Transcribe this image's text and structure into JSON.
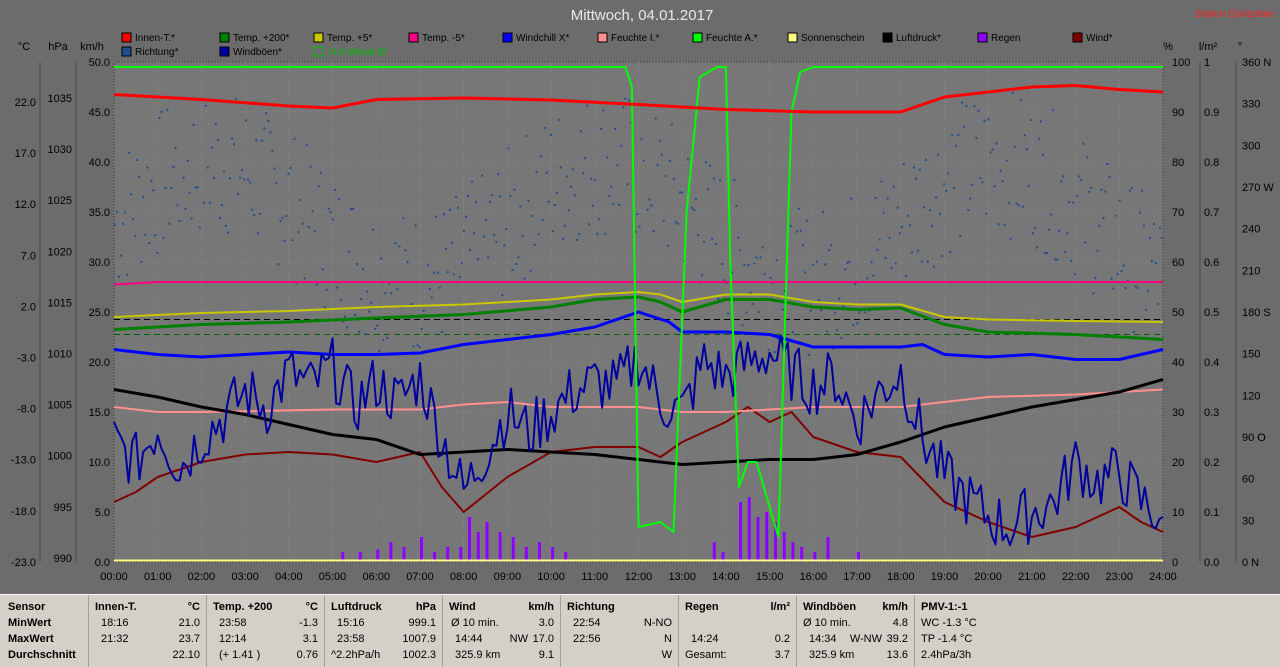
{
  "title": "Mittwoch, 04.01.2017",
  "station": "Station Göritzhain",
  "colors": {
    "background": "#6c6c6c",
    "plot_bg": "#757575",
    "innen": "#ff0000",
    "temp200": "#008000",
    "temp5": "#c8c800",
    "temp_5": "#ff0080",
    "windchill": "#0000ff",
    "feuchte_i": "#ff9090",
    "feuchte_a": "#00ff00",
    "sonnenschein": "#ffff80",
    "luftdruck": "#000000",
    "regen": "#9000ff",
    "wind": "#800000",
    "richtung": "#1f4f8f",
    "windboeen": "#0000a0",
    "monat": "#00c000",
    "station_text": "#ff0000"
  },
  "legend": [
    {
      "label": "Innen-T.*",
      "color": "#ff0000"
    },
    {
      "label": "Temp. +200*",
      "color": "#008000"
    },
    {
      "label": "Temp. +5*",
      "color": "#c8c800"
    },
    {
      "label": "Temp. -5*",
      "color": "#ff0080"
    },
    {
      "label": "Windchill X*",
      "color": "#0000ff"
    },
    {
      "label": "Feuchte I.*",
      "color": "#ff9090"
    },
    {
      "label": "Feuchte A.*",
      "color": "#00ff00"
    },
    {
      "label": "Sonnenschein",
      "color": "#ffff80"
    },
    {
      "label": "Luftdruck*",
      "color": "#000000"
    },
    {
      "label": "Regen",
      "color": "#9000ff"
    },
    {
      "label": "Wind*",
      "color": "#800000"
    },
    {
      "label": "Richtung*",
      "color": "#1f4f8f"
    },
    {
      "label": "Windböen*",
      "color": "#0000a0"
    },
    {
      "label": "-0.6 Monat-Ø",
      "color": "#00c000",
      "outline": true
    }
  ],
  "axis_headers": {
    "c": "°C",
    "hpa": "hPa",
    "kmh": "km/h",
    "pct": "%",
    "lm2": "l/m²",
    "deg": "°"
  },
  "axes": {
    "temp": [
      "22.0",
      "17.0",
      "12.0",
      "7.0",
      "2.0",
      "-3.0",
      "-8.0",
      "-13.0",
      "-18.0",
      "-23.0"
    ],
    "hpa": [
      "1035",
      "1030",
      "1025",
      "1020",
      "1015",
      "1010",
      "1005",
      "1000",
      "995",
      "990"
    ],
    "kmh": [
      "50.0",
      "45.0",
      "40.0",
      "35.0",
      "30.0",
      "25.0",
      "20.0",
      "15.0",
      "10.0",
      "5.0",
      "0.0"
    ],
    "pct": [
      "100",
      "90",
      "80",
      "70",
      "60",
      "50",
      "40",
      "30",
      "20",
      "10",
      "0"
    ],
    "lm2": [
      "1",
      "0.9",
      "0.8",
      "0.7",
      "0.6",
      "0.5",
      "0.4",
      "0.3",
      "0.2",
      "0.1",
      "0.0"
    ],
    "deg": [
      "360 N",
      "330",
      "300",
      "270 W",
      "240",
      "210",
      "180 S",
      "150",
      "120",
      "90 O",
      "60",
      "30",
      "0 N"
    ],
    "x": [
      "00:00",
      "01:00",
      "02:00",
      "03:00",
      "04:00",
      "05:00",
      "06:00",
      "07:00",
      "08:00",
      "09:00",
      "10:00",
      "11:00",
      "12:00",
      "13:00",
      "14:00",
      "15:00",
      "16:00",
      "17:00",
      "18:00",
      "19:00",
      "20:00",
      "21:00",
      "22:00",
      "23:00",
      "24:00"
    ]
  },
  "chart_data": {
    "type": "line",
    "title": "Mittwoch, 04.01.2017",
    "x_unit": "hour",
    "xlim": [
      0,
      24
    ],
    "ylim_kmh": [
      0,
      50
    ],
    "ylim_pct": [
      0,
      100
    ],
    "grid": true,
    "series": [
      {
        "name": "Innen-T.*",
        "axis": "pct",
        "x": [
          0,
          2,
          4,
          5,
          6,
          8,
          10,
          12,
          14,
          16,
          18,
          19,
          21,
          22,
          23,
          24
        ],
        "y": [
          93.5,
          92.5,
          91.2,
          90.8,
          92.5,
          92.8,
          92.4,
          91.5,
          90.5,
          90,
          90,
          93,
          95,
          95.3,
          94.5,
          94
        ]
      },
      {
        "name": "Temp. +200*",
        "axis": "pct",
        "x": [
          0,
          2,
          4,
          6,
          8,
          10,
          11,
          12,
          12.5,
          13,
          14,
          15,
          16,
          17,
          18,
          19,
          20,
          22,
          24
        ],
        "y": [
          46.5,
          47.5,
          48,
          48.8,
          49.5,
          51,
          52.5,
          53,
          52,
          50,
          52.5,
          52.5,
          51,
          50.5,
          50.8,
          47.5,
          46,
          45.5,
          44.5
        ]
      },
      {
        "name": "Temp. +5*",
        "axis": "pct",
        "x": [
          0,
          2,
          4,
          6,
          8,
          10,
          11,
          12,
          12.5,
          13,
          14,
          15,
          16,
          17,
          18,
          19,
          20,
          22,
          24
        ],
        "y": [
          49,
          49.8,
          50.2,
          51,
          51.5,
          52.5,
          53.5,
          54,
          53.5,
          52,
          53.5,
          53.5,
          52,
          51.5,
          51.5,
          49,
          48.5,
          48.2,
          48
        ]
      },
      {
        "name": "Temp. -5*",
        "axis": "pct",
        "x": [
          0,
          1,
          24
        ],
        "y": [
          55.5,
          56,
          56
        ]
      },
      {
        "name": "Windchill X*",
        "axis": "pct",
        "x": [
          0,
          1,
          2,
          3,
          4,
          5,
          6,
          7,
          8,
          9,
          10,
          11,
          12,
          12.7,
          13,
          14,
          15,
          16,
          17,
          18,
          18.5,
          19,
          20,
          21,
          22,
          23,
          24
        ],
        "y": [
          42.5,
          41.5,
          41,
          41.5,
          42,
          41.5,
          41.5,
          41.8,
          43.5,
          44.5,
          45.5,
          47,
          50,
          48,
          46,
          46,
          45.5,
          43,
          43,
          43,
          43.5,
          41.5,
          41,
          41.5,
          40.5,
          40.5,
          42.5
        ]
      },
      {
        "name": "Feuchte I.*",
        "axis": "pct",
        "x": [
          0,
          1,
          2,
          5,
          7,
          8,
          9,
          10,
          11,
          12,
          13,
          14,
          15,
          16,
          17,
          18,
          19,
          20,
          22,
          23,
          24
        ],
        "y": [
          31,
          30,
          30,
          30.5,
          30.5,
          31.5,
          32,
          31,
          31,
          31,
          30,
          30,
          30.5,
          31,
          31,
          31,
          32,
          33,
          33.5,
          34,
          34.5
        ]
      },
      {
        "name": "Feuchte A.*",
        "axis": "pct",
        "x": [
          0,
          11.7,
          11.85,
          12,
          12.5,
          12.8,
          13.1,
          13.4,
          13.8,
          14,
          14.1,
          14.3,
          14.5,
          14.7,
          15.2,
          15.5,
          15.7,
          16,
          24
        ],
        "y": [
          99,
          99,
          95,
          7,
          8,
          6,
          70,
          97,
          99,
          99,
          60,
          15,
          20,
          20,
          5,
          90,
          98,
          99,
          99
        ]
      },
      {
        "name": "Sonnenschein",
        "axis": "pct",
        "x": [
          0,
          24
        ],
        "y": [
          0.3,
          0.3
        ]
      },
      {
        "name": "Luftdruck*",
        "axis": "pct",
        "x": [
          0,
          1,
          2,
          3,
          4,
          5,
          6,
          7,
          8,
          9,
          10,
          11,
          12,
          13,
          14,
          15,
          16,
          17,
          18,
          19,
          20,
          21,
          22,
          23,
          24
        ],
        "y": [
          34.5,
          33,
          31,
          29.5,
          27.5,
          25.5,
          24.5,
          21.5,
          22,
          22.5,
          22,
          21.5,
          20.5,
          19.5,
          20,
          20.5,
          20.5,
          21.5,
          24,
          27,
          29,
          31,
          32.5,
          34,
          36.5
        ]
      },
      {
        "name": "Wind*",
        "axis": "pct",
        "x": [
          0,
          0.5,
          1,
          2,
          3,
          4,
          5,
          6,
          7,
          7.5,
          8,
          9,
          10,
          11,
          12,
          12.5,
          13,
          14,
          14.5,
          15,
          15.5,
          16,
          17,
          18,
          19,
          20,
          21,
          22,
          23,
          23.5,
          24
        ],
        "y": [
          12,
          14,
          17,
          20,
          21.5,
          22,
          21.5,
          20,
          22,
          15,
          10,
          17,
          22,
          23,
          23,
          21,
          24,
          28,
          31,
          28,
          30,
          25,
          22,
          21,
          12,
          8,
          5,
          7,
          11,
          8,
          6
        ]
      },
      {
        "name": "Windböen*",
        "axis": "pct",
        "x": [
          0,
          0.5,
          1,
          1.5,
          2,
          2.5,
          3,
          3.5,
          4,
          4.5,
          5,
          5.5,
          6,
          6.5,
          7,
          7.5,
          8,
          8.5,
          9,
          9.5,
          10,
          10.5,
          11,
          11.5,
          12,
          12.5,
          13,
          13.5,
          14,
          14.5,
          15,
          15.5,
          16,
          16.5,
          17,
          17.5,
          18,
          18.5,
          19,
          19.5,
          20,
          20.5,
          21,
          21.5,
          22,
          22.5,
          23,
          23.5,
          24
        ],
        "y": [
          24,
          20,
          27,
          19,
          25,
          29,
          34,
          31,
          38,
          35,
          39,
          31,
          36,
          32,
          37,
          25,
          14,
          22,
          30,
          26,
          30,
          34,
          36,
          35,
          41,
          32,
          30,
          40,
          37,
          40,
          42,
          38,
          35,
          37,
          28,
          34,
          38,
          25,
          17,
          13,
          9,
          7,
          10,
          12,
          20,
          16,
          18,
          12,
          9
        ]
      },
      {
        "name": "Regen",
        "axis": "lm2",
        "type": "bar",
        "x": [
          5.2,
          5.6,
          6,
          6.3,
          6.6,
          7,
          7.3,
          7.6,
          7.9,
          8.1,
          8.3,
          8.5,
          8.8,
          9.1,
          9.4,
          9.7,
          10,
          10.3,
          13.7,
          13.9,
          14.3,
          14.5,
          14.7,
          14.9,
          15.1,
          15.3,
          15.5,
          15.7,
          16,
          16.3,
          17
        ],
        "y": [
          0.02,
          0.02,
          0.025,
          0.04,
          0.03,
          0.05,
          0.02,
          0.03,
          0.03,
          0.09,
          0.06,
          0.08,
          0.06,
          0.05,
          0.03,
          0.04,
          0.03,
          0.02,
          0.04,
          0.02,
          0.12,
          0.13,
          0.09,
          0.1,
          0.08,
          0.06,
          0.04,
          0.03,
          0.02,
          0.05,
          0.02
        ]
      }
    ],
    "reference_lines_pct": [
      48.5,
      45.5
    ]
  },
  "table": {
    "labels": {
      "sensor": "Sensor",
      "min": "MinWert",
      "max": "MaxWert",
      "avg": "Durchschnitt"
    },
    "innen": {
      "title": "Innen-T.",
      "unit": "°C",
      "min_time": "18:16",
      "min_val": "21.0",
      "max_time": "21:32",
      "max_val": "23.7",
      "avg": "22.10"
    },
    "temp200": {
      "title": "Temp. +200",
      "unit": "°C",
      "min_time": "23:58",
      "min_val": "-1.3",
      "max_time": "12:14",
      "max_val": "3.1",
      "avg_note": "(+ 1.41 )",
      "avg": "0.76"
    },
    "luftdruck": {
      "title": "Luftdruck",
      "unit": "hPa",
      "min_time": "15:16",
      "min_val": "999.1",
      "max_time": "23:58",
      "max_val": "1007.9",
      "avg_note": "^2.2hPa/h",
      "avg": "1002.3"
    },
    "wind": {
      "title": "Wind",
      "unit": "km/h",
      "min_time": "Ø 10 min.",
      "min_val": "3.0",
      "max_time": "14:44",
      "max_dir": "NW",
      "max_val": "17.0",
      "avg_note": "325.9 km",
      "avg": "9.1"
    },
    "richtung": {
      "title": "Richtung",
      "min_time": "22:54",
      "min_val": "N-NO",
      "max_time": "22:56",
      "max_val": "N",
      "avg": "W"
    },
    "regen": {
      "title": "Regen",
      "unit": "l/m²",
      "max_time": "14:24",
      "max_val": "0.2",
      "avg_note": "Gesamt:",
      "avg": "3.7"
    },
    "windboeen": {
      "title": "Windböen",
      "unit": "km/h",
      "min_time": "Ø 10 min.",
      "min_val": "4.8",
      "max_time": "14:34",
      "max_dir": "W-NW",
      "max_val": "39.2",
      "avg_note": "325.9 km",
      "avg": "13.6"
    },
    "pmv": {
      "title": "PMV-1:-1",
      "min": "WC -1.3 °C",
      "max": "TP -1.4 °C",
      "avg": "2.4hPa/3h"
    }
  }
}
